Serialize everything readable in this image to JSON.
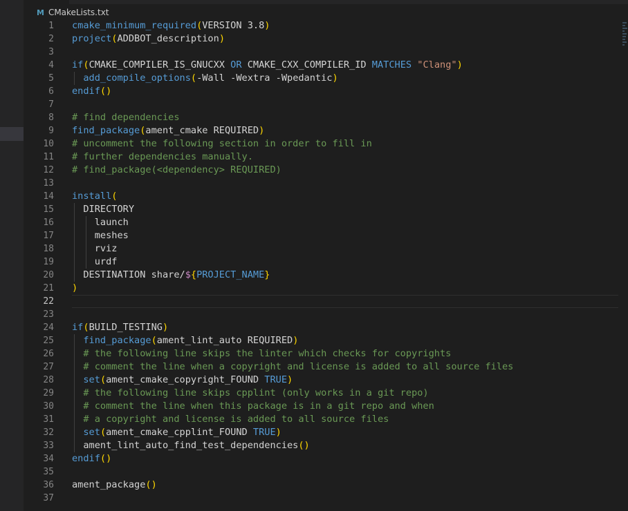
{
  "breadcrumb": {
    "icon": "cmake-file-icon",
    "icon_glyph": "M",
    "filename": "CMakeLists.txt"
  },
  "editor": {
    "current_line": 22,
    "lines": [
      {
        "n": "1",
        "tokens": [
          [
            "fn",
            "cmake_minimum_required"
          ],
          [
            "br",
            "("
          ],
          [
            "plain",
            "VERSION 3.8"
          ],
          [
            "br",
            ")"
          ]
        ]
      },
      {
        "n": "2",
        "tokens": [
          [
            "fn",
            "project"
          ],
          [
            "br",
            "("
          ],
          [
            "plain",
            "ADDBOT_description"
          ],
          [
            "br",
            ")"
          ]
        ]
      },
      {
        "n": "3",
        "tokens": []
      },
      {
        "n": "4",
        "tokens": [
          [
            "fn",
            "if"
          ],
          [
            "br",
            "("
          ],
          [
            "plain",
            "CMAKE_COMPILER_IS_GNUCXX "
          ],
          [
            "kw",
            "OR"
          ],
          [
            "plain",
            " CMAKE_CXX_COMPILER_ID "
          ],
          [
            "kw",
            "MATCHES"
          ],
          [
            "plain",
            " "
          ],
          [
            "str",
            "\"Clang\""
          ],
          [
            "br",
            ")"
          ]
        ]
      },
      {
        "n": "5",
        "tokens": [
          [
            "plain",
            "  "
          ],
          [
            "fn",
            "add_compile_options"
          ],
          [
            "br",
            "("
          ],
          [
            "plain",
            "-Wall -Wextra -Wpedantic"
          ],
          [
            "br",
            ")"
          ]
        ]
      },
      {
        "n": "6",
        "tokens": [
          [
            "fn",
            "endif"
          ],
          [
            "br",
            "()"
          ]
        ]
      },
      {
        "n": "7",
        "tokens": []
      },
      {
        "n": "8",
        "tokens": [
          [
            "cmt",
            "# find dependencies"
          ]
        ]
      },
      {
        "n": "9",
        "tokens": [
          [
            "fn",
            "find_package"
          ],
          [
            "br",
            "("
          ],
          [
            "plain",
            "ament_cmake REQUIRED"
          ],
          [
            "br",
            ")"
          ]
        ]
      },
      {
        "n": "10",
        "tokens": [
          [
            "cmt",
            "# uncomment the following section in order to fill in"
          ]
        ]
      },
      {
        "n": "11",
        "tokens": [
          [
            "cmt",
            "# further dependencies manually."
          ]
        ]
      },
      {
        "n": "12",
        "tokens": [
          [
            "cmt",
            "# find_package(<dependency> REQUIRED)"
          ]
        ]
      },
      {
        "n": "13",
        "tokens": []
      },
      {
        "n": "14",
        "tokens": [
          [
            "fn",
            "install"
          ],
          [
            "br",
            "("
          ]
        ]
      },
      {
        "n": "15",
        "tokens": [
          [
            "plain",
            "  DIRECTORY"
          ]
        ]
      },
      {
        "n": "16",
        "tokens": [
          [
            "plain",
            "    launch"
          ]
        ]
      },
      {
        "n": "17",
        "tokens": [
          [
            "plain",
            "    meshes"
          ]
        ]
      },
      {
        "n": "18",
        "tokens": [
          [
            "plain",
            "    rviz"
          ]
        ]
      },
      {
        "n": "19",
        "tokens": [
          [
            "plain",
            "    urdf"
          ]
        ]
      },
      {
        "n": "20",
        "tokens": [
          [
            "plain",
            "  DESTINATION share/"
          ],
          [
            "dol",
            "$"
          ],
          [
            "br",
            "{"
          ],
          [
            "var",
            "PROJECT_NAME"
          ],
          [
            "br",
            "}"
          ]
        ]
      },
      {
        "n": "21",
        "tokens": [
          [
            "br",
            ")"
          ]
        ]
      },
      {
        "n": "22",
        "tokens": []
      },
      {
        "n": "23",
        "tokens": []
      },
      {
        "n": "24",
        "tokens": [
          [
            "fn",
            "if"
          ],
          [
            "br",
            "("
          ],
          [
            "plain",
            "BUILD_TESTING"
          ],
          [
            "br",
            ")"
          ]
        ]
      },
      {
        "n": "25",
        "tokens": [
          [
            "plain",
            "  "
          ],
          [
            "fn",
            "find_package"
          ],
          [
            "br",
            "("
          ],
          [
            "plain",
            "ament_lint_auto REQUIRED"
          ],
          [
            "br",
            ")"
          ]
        ]
      },
      {
        "n": "26",
        "tokens": [
          [
            "plain",
            "  "
          ],
          [
            "cmt",
            "# the following line skips the linter which checks for copyrights"
          ]
        ]
      },
      {
        "n": "27",
        "tokens": [
          [
            "plain",
            "  "
          ],
          [
            "cmt",
            "# comment the line when a copyright and license is added to all source files"
          ]
        ]
      },
      {
        "n": "28",
        "tokens": [
          [
            "plain",
            "  "
          ],
          [
            "fn",
            "set"
          ],
          [
            "br",
            "("
          ],
          [
            "plain",
            "ament_cmake_copyright_FOUND "
          ],
          [
            "kw",
            "TRUE"
          ],
          [
            "br",
            ")"
          ]
        ]
      },
      {
        "n": "29",
        "tokens": [
          [
            "plain",
            "  "
          ],
          [
            "cmt",
            "# the following line skips cpplint (only works in a git repo)"
          ]
        ]
      },
      {
        "n": "30",
        "tokens": [
          [
            "plain",
            "  "
          ],
          [
            "cmt",
            "# comment the line when this package is in a git repo and when"
          ]
        ]
      },
      {
        "n": "31",
        "tokens": [
          [
            "plain",
            "  "
          ],
          [
            "cmt",
            "# a copyright and license is added to all source files"
          ]
        ]
      },
      {
        "n": "32",
        "tokens": [
          [
            "plain",
            "  "
          ],
          [
            "fn",
            "set"
          ],
          [
            "br",
            "("
          ],
          [
            "plain",
            "ament_cmake_cpplint_FOUND "
          ],
          [
            "kw",
            "TRUE"
          ],
          [
            "br",
            ")"
          ]
        ]
      },
      {
        "n": "33",
        "tokens": [
          [
            "plain",
            "  ament_lint_auto_find_test_dependencies"
          ],
          [
            "br",
            "()"
          ]
        ]
      },
      {
        "n": "34",
        "tokens": [
          [
            "fn",
            "endif"
          ],
          [
            "br",
            "()"
          ]
        ]
      },
      {
        "n": "35",
        "tokens": []
      },
      {
        "n": "36",
        "tokens": [
          [
            "plain",
            "ament_package"
          ],
          [
            "br",
            "()"
          ]
        ]
      },
      {
        "n": "37",
        "tokens": []
      }
    ]
  },
  "colors": {
    "background": "#1e1e1e",
    "function": "#569cd6",
    "comment": "#6a9955",
    "string": "#ce9178",
    "bracket": "#ffd700",
    "dollar": "#c586c0"
  }
}
